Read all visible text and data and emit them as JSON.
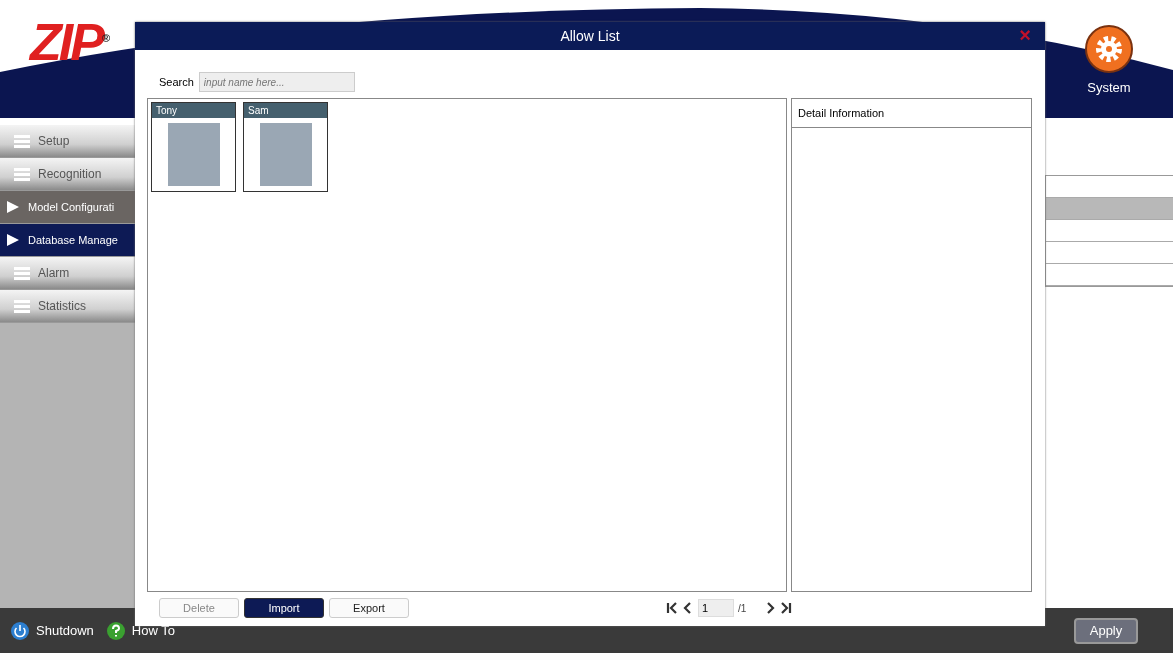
{
  "app": {
    "logo": "ZIP",
    "logo_mark": "®",
    "system_label": "System",
    "sidebar": [
      {
        "label": "Setup",
        "kind": "group",
        "selected": false
      },
      {
        "label": "Recognition",
        "kind": "group",
        "selected": false
      },
      {
        "label": "Model Configurati",
        "kind": "sub",
        "selected": false
      },
      {
        "label": "Database Manage",
        "kind": "sub",
        "selected": true
      },
      {
        "label": "Alarm",
        "kind": "group",
        "selected": false
      },
      {
        "label": "Statistics",
        "kind": "group",
        "selected": false
      }
    ],
    "table_rows": [
      {
        "selected": false
      },
      {
        "selected": true
      },
      {
        "selected": false
      },
      {
        "selected": false
      },
      {
        "selected": false
      }
    ],
    "bottom_bar": {
      "shutdown": "Shutdown",
      "how_to": "How To",
      "apply": "Apply"
    }
  },
  "dialog": {
    "title": "Allow List",
    "close": "×",
    "search": {
      "label": "Search",
      "placeholder": "input name here..."
    },
    "people": [
      {
        "name": "Tony"
      },
      {
        "name": "Sam"
      }
    ],
    "detail_header": "Detail Information",
    "buttons": [
      {
        "label": "Delete",
        "disabled": true,
        "primary": false
      },
      {
        "label": "Import",
        "disabled": false,
        "primary": true
      },
      {
        "label": "Export",
        "disabled": false,
        "primary": false
      }
    ],
    "pager": {
      "page": "1",
      "total": "/1"
    }
  }
}
